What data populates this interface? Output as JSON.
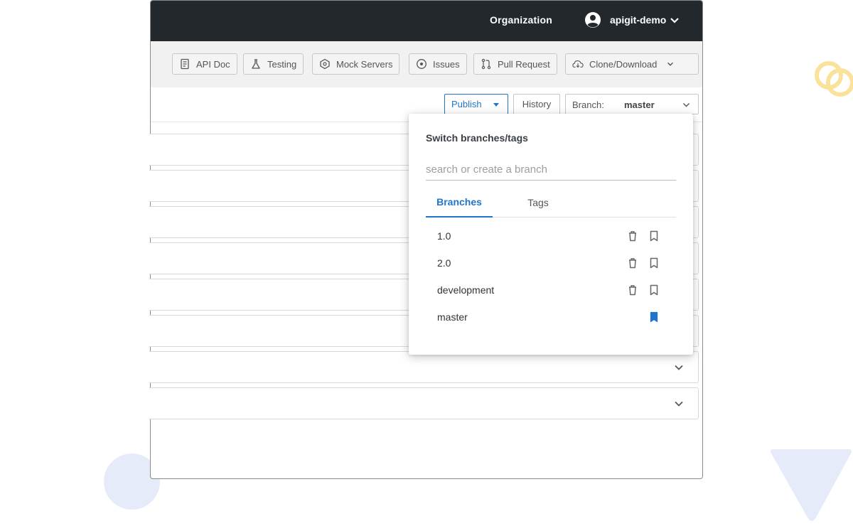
{
  "topbar": {
    "organization_label": "Organization",
    "user_name": "apigit-demo"
  },
  "toolbar": {
    "buttons": [
      {
        "label": "API Doc",
        "icon": "document-icon"
      },
      {
        "label": "Testing",
        "icon": "flask-icon"
      },
      {
        "label": "Mock Servers",
        "icon": "mock-server-icon"
      },
      {
        "label": "Issues",
        "icon": "issue-icon"
      },
      {
        "label": "Pull Request",
        "icon": "pull-request-icon"
      },
      {
        "label": "Clone/Download",
        "icon": "cloud-download-icon"
      }
    ]
  },
  "subbar": {
    "publish_label": "Publish",
    "history_label": "History",
    "branch_label": "Branch:",
    "branch_value": "master"
  },
  "branch_popover": {
    "title": "Switch branches/tags",
    "search_placeholder": "search or create a branch",
    "tabs": [
      "Branches",
      "Tags"
    ],
    "active_tab": "Branches",
    "branches": [
      {
        "name": "1.0",
        "deletable": true,
        "default": false
      },
      {
        "name": "2.0",
        "deletable": true,
        "default": false
      },
      {
        "name": "development",
        "deletable": true,
        "default": false
      },
      {
        "name": "master",
        "deletable": false,
        "default": true
      }
    ]
  },
  "colors": {
    "topbar_bg": "#23282d",
    "accent": "#1f75cb",
    "toolbar_bg": "#f1f1f1"
  }
}
